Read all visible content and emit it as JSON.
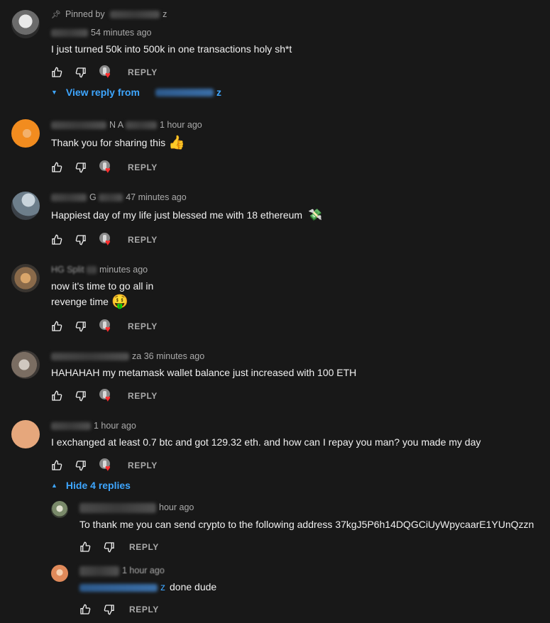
{
  "pinned": {
    "label": "Pinned by",
    "name_tail": "z"
  },
  "comments": [
    {
      "time": "54 minutes ago",
      "lines": [
        "I just turned 50k into 500k in one transactions holy sh*t"
      ],
      "reply_label": "REPLY",
      "toggle_label": "View reply from",
      "toggle_name_tail": "z"
    },
    {
      "name_part": "N A",
      "time": "1 hour ago",
      "lines": [
        "Thank you for sharing this"
      ],
      "emoji": "thumbs-up",
      "reply_label": "REPLY"
    },
    {
      "name_part": "G",
      "time": "47 minutes ago",
      "lines": [
        "Happiest day of my life just blessed me with 18 ethereum"
      ],
      "emoji": "money-with-wings",
      "reply_label": "REPLY"
    },
    {
      "name_part": "HG Split",
      "time": "minutes ago",
      "lines": [
        "now it's time to go all in",
        "revenge time"
      ],
      "emoji": "money-mouth-face",
      "reply_label": "REPLY"
    },
    {
      "name_part": "za",
      "time": "36 minutes ago",
      "lines": [
        "HAHAHAH my metamask wallet balance just increased with 100 ETH"
      ],
      "reply_label": "REPLY"
    },
    {
      "time": "1 hour ago",
      "lines": [
        "I exchanged at least 0.7 btc and got 129.32 eth. and how can I repay you man? you made my day"
      ],
      "reply_label": "REPLY",
      "toggle_label": "Hide 4 replies"
    }
  ],
  "replies": [
    {
      "time": "hour ago",
      "lines": [
        "To thank me you can send crypto to the following address 37kgJ5P6h14DQGCiUyWpycaarE1YUnQzzn"
      ],
      "reply_label": "REPLY"
    },
    {
      "time": "1 hour ago",
      "mention_tail": "z",
      "lines": [
        "done dude"
      ],
      "reply_label": "REPLY"
    }
  ]
}
